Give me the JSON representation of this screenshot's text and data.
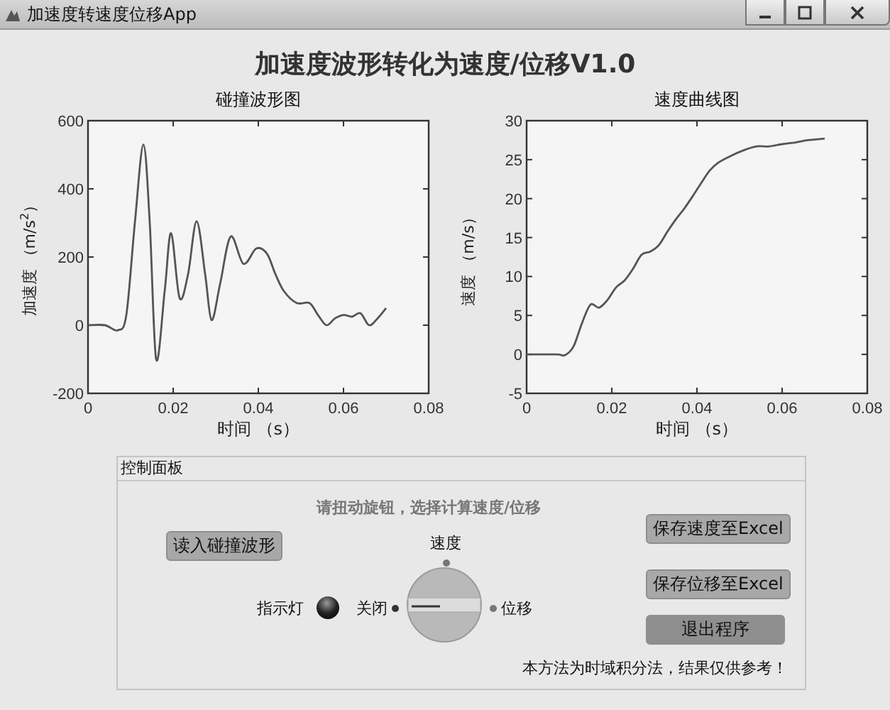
{
  "window": {
    "title": "加速度转速度位移App"
  },
  "heading": "加速度波形转化为速度/位移V1.0",
  "charts": [
    {
      "chart_data": {
        "type": "line",
        "title": "碰撞波形图",
        "xlabel": "时间 （s）",
        "ylabel": "加速度 （m/s$^{2}$）",
        "x": [
          0,
          0.004,
          0.007,
          0.009,
          0.011,
          0.013,
          0.0145,
          0.016,
          0.018,
          0.0195,
          0.0215,
          0.0235,
          0.0255,
          0.0275,
          0.029,
          0.031,
          0.0335,
          0.0365,
          0.0395,
          0.042,
          0.044,
          0.046,
          0.049,
          0.052,
          0.054,
          0.056,
          0.058,
          0.06,
          0.062,
          0.064,
          0.066,
          0.068,
          0.07
        ],
        "series": [
          {
            "color": "#555555",
            "values": [
              0,
              0,
              -15,
              30,
              300,
              530,
              300,
              -100,
              100,
              270,
              80,
              150,
              305,
              150,
              15,
              120,
              260,
              180,
              225,
              210,
              150,
              100,
              65,
              65,
              30,
              0,
              20,
              30,
              25,
              35,
              0,
              20,
              50
            ]
          }
        ],
        "xlim": [
          0,
          0.08
        ],
        "ylim": [
          -200,
          600
        ],
        "xticks": [
          0,
          0.02,
          0.04,
          0.06,
          0.08
        ],
        "yticks": [
          -200,
          0,
          200,
          400,
          600
        ]
      }
    },
    {
      "chart_data": {
        "type": "line",
        "title": "速度曲线图",
        "xlabel": "时间 （s）",
        "ylabel": "速度 （m/s）",
        "x": [
          0,
          0.007,
          0.009,
          0.011,
          0.013,
          0.015,
          0.017,
          0.019,
          0.021,
          0.023,
          0.025,
          0.027,
          0.029,
          0.031,
          0.033,
          0.035,
          0.037,
          0.039,
          0.041,
          0.043,
          0.045,
          0.048,
          0.051,
          0.054,
          0.057,
          0.06,
          0.063,
          0.066,
          0.07
        ],
        "series": [
          {
            "color": "#555555",
            "values": [
              0,
              0,
              -0.1,
              1,
              4,
              6.4,
              6,
              7,
              8.6,
              9.5,
              11,
              12.8,
              13.2,
              14,
              15.7,
              17.3,
              18.7,
              20.3,
              22,
              23.6,
              24.6,
              25.5,
              26.2,
              26.7,
              26.7,
              27,
              27.2,
              27.5,
              27.7
            ]
          }
        ],
        "xlim": [
          0,
          0.08
        ],
        "ylim": [
          -5,
          30
        ],
        "xticks": [
          0,
          0.02,
          0.04,
          0.06,
          0.08
        ],
        "yticks": [
          -5,
          0,
          5,
          10,
          15,
          20,
          25,
          30
        ]
      }
    }
  ],
  "control_panel": {
    "title": "控制面板",
    "hint": "请扭动旋钮，选择计算速度/位移",
    "load_button": "读入碰撞波形",
    "indicator": {
      "label": "指示灯",
      "on": false
    },
    "knob": {
      "positions": [
        {
          "kind": "left",
          "label": "关闭",
          "selected": true
        },
        {
          "kind": "top",
          "label": "速度",
          "selected": false
        },
        {
          "kind": "right",
          "label": "位移",
          "selected": false
        }
      ]
    },
    "buttons": [
      {
        "label": "保存速度至Excel",
        "kind": "normal"
      },
      {
        "label": "保存位移至Excel",
        "kind": "normal"
      },
      {
        "label": "退出程序",
        "kind": "dark"
      }
    ],
    "note": "本方法为时域积分法，结果仅供参考！"
  }
}
